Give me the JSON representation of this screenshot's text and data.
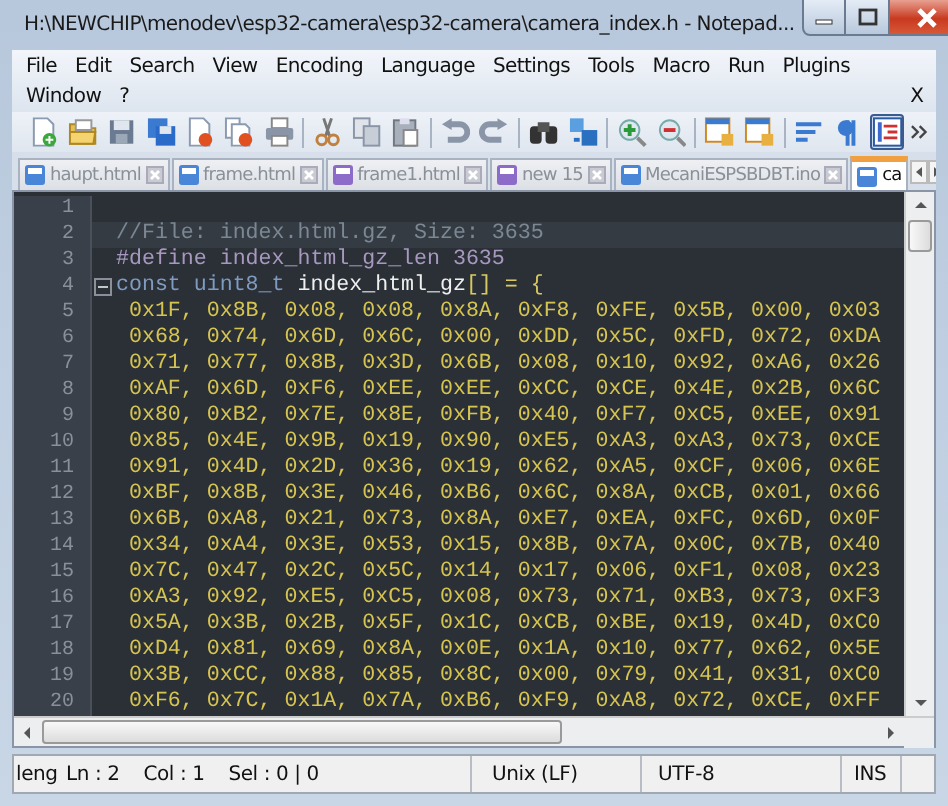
{
  "window": {
    "title": "H:\\NEWCHIP\\menodev\\esp32-camera\\esp32-camera\\camera_index.h - Notepad..."
  },
  "menu": {
    "items": [
      "File",
      "Edit",
      "Search",
      "View",
      "Encoding",
      "Language",
      "Settings",
      "Tools",
      "Macro",
      "Run",
      "Plugins",
      "Window",
      "?"
    ],
    "close_label": "X"
  },
  "toolbar": [
    {
      "kind": "new",
      "pressed": false
    },
    {
      "kind": "open",
      "pressed": false
    },
    {
      "kind": "save",
      "pressed": false
    },
    {
      "kind": "saveall",
      "pressed": false
    },
    {
      "kind": "close",
      "pressed": false
    },
    {
      "kind": "closeall",
      "pressed": false
    },
    {
      "kind": "print",
      "pressed": false
    },
    {
      "kind": "separator"
    },
    {
      "kind": "cut",
      "pressed": false
    },
    {
      "kind": "copy",
      "pressed": false
    },
    {
      "kind": "paste",
      "pressed": false
    },
    {
      "kind": "separator"
    },
    {
      "kind": "undo",
      "pressed": false
    },
    {
      "kind": "redo",
      "pressed": false
    },
    {
      "kind": "separator"
    },
    {
      "kind": "find",
      "pressed": false
    },
    {
      "kind": "replace",
      "pressed": false
    },
    {
      "kind": "separator"
    },
    {
      "kind": "zoomin",
      "pressed": false
    },
    {
      "kind": "zoomout",
      "pressed": false
    },
    {
      "kind": "separator"
    },
    {
      "kind": "syncv",
      "pressed": false
    },
    {
      "kind": "synch",
      "pressed": false
    },
    {
      "kind": "separator"
    },
    {
      "kind": "wrap",
      "pressed": false
    },
    {
      "kind": "pilcrow",
      "pressed": false
    },
    {
      "kind": "indent",
      "pressed": true
    },
    {
      "kind": "more"
    }
  ],
  "tabs": [
    {
      "label": "haupt.html",
      "selected": false,
      "color": "#4a86d8"
    },
    {
      "label": "frame.html",
      "selected": false,
      "color": "#4a86d8"
    },
    {
      "label": "frame1.html",
      "selected": false,
      "color": "#8c6cc8"
    },
    {
      "label": "new 15",
      "selected": false,
      "color": "#8c6cc8"
    },
    {
      "label": "MecaniESPSBDBT.ino",
      "selected": false,
      "color": "#4a86d8"
    },
    {
      "label": "ca",
      "selected": true,
      "color": "#4a86d8"
    }
  ],
  "editor": {
    "lines": [
      {
        "number": "1",
        "current": false,
        "fold": false
      },
      {
        "number": "2",
        "current": true,
        "fold": false,
        "tokens": [
          {
            "kind": "comment",
            "text": "//File: index.html.gz, Size: 3635"
          }
        ]
      },
      {
        "number": "3",
        "current": false,
        "fold": false,
        "tokens": [
          {
            "kind": "preprocessor",
            "text": "#define index_html_gz_len 3635"
          }
        ]
      },
      {
        "number": "4",
        "current": false,
        "fold": true,
        "tokens": [
          {
            "kind": "keyword",
            "text": "const uint8_t"
          },
          {
            "kind": "identifier",
            "text": " index_html_gz"
          },
          {
            "kind": "operator",
            "text": "[] = {"
          }
        ]
      },
      {
        "number": "5",
        "current": false,
        "fold": false,
        "tokens": [
          {
            "kind": "number",
            "text": " 0x1F, 0x8B, 0x08, 0x08, 0x8A, 0xF8, 0xFE, 0x5B, 0x00, 0x03"
          }
        ]
      },
      {
        "number": "6",
        "current": false,
        "fold": false,
        "tokens": [
          {
            "kind": "number",
            "text": " 0x68, 0x74, 0x6D, 0x6C, 0x00, 0xDD, 0x5C, 0xFD, 0x72, 0xDA"
          }
        ]
      },
      {
        "number": "7",
        "current": false,
        "fold": false,
        "tokens": [
          {
            "kind": "number",
            "text": " 0x71, 0x77, 0x8B, 0x3D, 0x6B, 0x08, 0x10, 0x92, 0xA6, 0x26"
          }
        ]
      },
      {
        "number": "8",
        "current": false,
        "fold": false,
        "tokens": [
          {
            "kind": "number",
            "text": " 0xAF, 0x6D, 0xF6, 0xEE, 0xEE, 0xCC, 0xCE, 0x4E, 0x2B, 0x6C"
          }
        ]
      },
      {
        "number": "9",
        "current": false,
        "fold": false,
        "tokens": [
          {
            "kind": "number",
            "text": " 0x80, 0xB2, 0x7E, 0x8E, 0xFB, 0x40, 0xF7, 0xC5, 0xEE, 0x91"
          }
        ]
      },
      {
        "number": "10",
        "current": false,
        "fold": false,
        "tokens": [
          {
            "kind": "number",
            "text": " 0x85, 0x4E, 0x9B, 0x19, 0x90, 0xE5, 0xA3, 0xA3, 0x73, 0xCE"
          }
        ]
      },
      {
        "number": "11",
        "current": false,
        "fold": false,
        "tokens": [
          {
            "kind": "number",
            "text": " 0x91, 0x4D, 0x2D, 0x36, 0x19, 0x62, 0xA5, 0xCF, 0x06, 0x6E"
          }
        ]
      },
      {
        "number": "12",
        "current": false,
        "fold": false,
        "tokens": [
          {
            "kind": "number",
            "text": " 0xBF, 0x8B, 0x3E, 0x46, 0xB6, 0x6C, 0x8A, 0xCB, 0x01, 0x66"
          }
        ]
      },
      {
        "number": "13",
        "current": false,
        "fold": false,
        "tokens": [
          {
            "kind": "number",
            "text": " 0x6B, 0xA8, 0x21, 0x73, 0x8A, 0xE7, 0xEA, 0xFC, 0x6D, 0x0F"
          }
        ]
      },
      {
        "number": "14",
        "current": false,
        "fold": false,
        "tokens": [
          {
            "kind": "number",
            "text": " 0x34, 0xA4, 0x3E, 0x53, 0x15, 0x8B, 0x7A, 0x0C, 0x7B, 0x40"
          }
        ]
      },
      {
        "number": "15",
        "current": false,
        "fold": false,
        "tokens": [
          {
            "kind": "number",
            "text": " 0x7C, 0x47, 0x2C, 0x5C, 0x14, 0x17, 0x06, 0xF1, 0x08, 0x23"
          }
        ]
      },
      {
        "number": "16",
        "current": false,
        "fold": false,
        "tokens": [
          {
            "kind": "number",
            "text": " 0xA3, 0x92, 0xE5, 0xC5, 0x08, 0x73, 0x71, 0xB3, 0x73, 0xF3"
          }
        ]
      },
      {
        "number": "17",
        "current": false,
        "fold": false,
        "tokens": [
          {
            "kind": "number",
            "text": " 0x5A, 0x3B, 0x2B, 0x5F, 0x1C, 0xCB, 0xBE, 0x19, 0x4D, 0xC0"
          }
        ]
      },
      {
        "number": "18",
        "current": false,
        "fold": false,
        "tokens": [
          {
            "kind": "number",
            "text": " 0xD4, 0x81, 0x69, 0x8A, 0x0E, 0x1A, 0x10, 0x77, 0x62, 0x5E"
          }
        ]
      },
      {
        "number": "19",
        "current": false,
        "fold": false,
        "tokens": [
          {
            "kind": "number",
            "text": " 0x3B, 0xCC, 0x88, 0x85, 0x8C, 0x00, 0x79, 0x41, 0x31, 0xC0"
          }
        ]
      },
      {
        "number": "20",
        "current": false,
        "fold": false,
        "tokens": [
          {
            "kind": "number",
            "text": " 0xF6, 0x7C, 0x1A, 0x7A, 0xB6, 0xF9, 0xA8, 0x72, 0xCE, 0xFF"
          }
        ]
      }
    ]
  },
  "status_bar": {
    "file_type": "leng",
    "position": "Ln : 2    Col : 1    Sel : 0 | 0",
    "eol": "Unix (LF)",
    "encoding": "UTF-8",
    "mode": "INS"
  }
}
